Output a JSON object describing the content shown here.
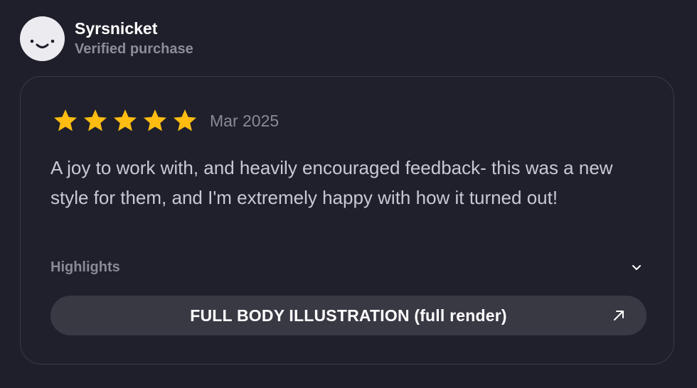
{
  "reviewer": {
    "name": "Syrsnicket",
    "status": "Verified purchase",
    "avatar_icon": "smiley-face-icon"
  },
  "review": {
    "rating": 5,
    "rating_max": 5,
    "date": "Mar 2025",
    "body": "A joy to work with, and heavily encouraged feedback- this was a new style for them, and I'm extremely happy with how it turned out!",
    "highlights_label": "Highlights",
    "product_label": "FULL BODY ILLUSTRATION (full render)",
    "icons": {
      "star": "star-icon",
      "expand": "chevron-down-icon",
      "open": "arrow-up-right-icon"
    }
  },
  "colors": {
    "background": "#1f1f2b",
    "star": "#ffbd12",
    "text_primary": "#ffffff",
    "text_muted": "#8a8a95",
    "pill": "#393944"
  }
}
